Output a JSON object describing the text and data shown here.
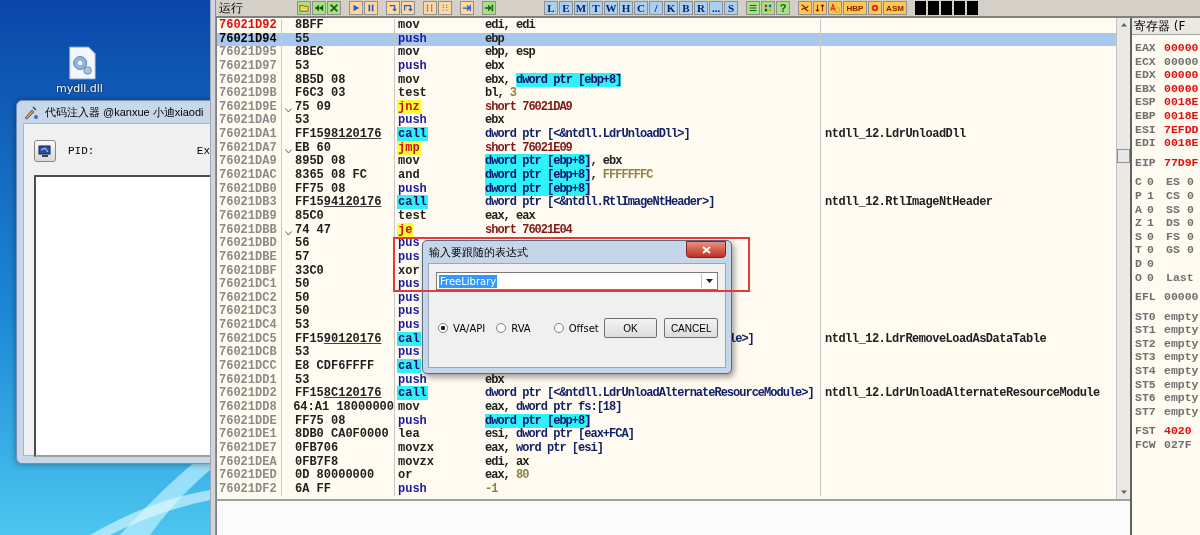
{
  "desktop": {
    "icon_label": "mydll.dll"
  },
  "injector": {
    "title": "代码注入器 @kanxue 小迪xiaodi",
    "pid_label": "PID:",
    "label_2": "Ex"
  },
  "toolbar": {
    "status": "运行",
    "letter_buttons": [
      "L",
      "E",
      "M",
      "T",
      "W",
      "H",
      "C",
      "/",
      "K",
      "B",
      "R",
      "...",
      "S"
    ],
    "help": "?",
    "text_icons": [
      "HBP",
      "ASM"
    ]
  },
  "rows": [
    {
      "address": "76021D92",
      "marked": true,
      "selected": false,
      "hex": "8BFF",
      "mnemonic": "mov",
      "kind": "plain",
      "operand": [
        {
          "kind": "plain",
          "text": "edi, edi"
        }
      ]
    },
    {
      "address": "76021D94",
      "marked": false,
      "selected": true,
      "hex": "55",
      "mnemonic": "push",
      "kind": "stack",
      "operand": [
        {
          "kind": "plain",
          "text": "ebp"
        }
      ]
    },
    {
      "address": "76021D95",
      "marked": false,
      "selected": false,
      "hex": "8BEC",
      "mnemonic": "mov",
      "kind": "plain",
      "operand": [
        {
          "kind": "plain",
          "text": "ebp, esp"
        }
      ]
    },
    {
      "address": "76021D97",
      "marked": false,
      "selected": false,
      "hex": "53",
      "mnemonic": "push",
      "kind": "stack",
      "operand": [
        {
          "kind": "plain",
          "text": "ebx"
        }
      ]
    },
    {
      "address": "76021D98",
      "marked": false,
      "selected": false,
      "hex": "8B5D 08",
      "mnemonic": "mov",
      "kind": "plain",
      "operand": [
        {
          "kind": "plain",
          "text": "ebx, "
        },
        {
          "kind": "mem",
          "text": "dword ptr [ebp+8]"
        }
      ]
    },
    {
      "address": "76021D9B",
      "marked": false,
      "selected": false,
      "hex": "F6C3 03",
      "mnemonic": "test",
      "kind": "plain",
      "operand": [
        {
          "kind": "plain",
          "text": "bl, "
        },
        {
          "kind": "const",
          "text": "3"
        }
      ]
    },
    {
      "address": "76021D9E",
      "marked": false,
      "selected": false,
      "hex": "75 09",
      "mnemonic": "jnz",
      "kind": "jump",
      "operand": [
        {
          "kind": "target",
          "text": "short 76021DA9"
        }
      ]
    },
    {
      "address": "76021DA0",
      "marked": false,
      "selected": false,
      "hex": "53",
      "mnemonic": "push",
      "kind": "stack",
      "operand": [
        {
          "kind": "plain",
          "text": "ebx"
        }
      ]
    },
    {
      "address": "76021DA1",
      "marked": false,
      "selected": false,
      "hex": "FF15",
      "fixup": "98120176",
      "mnemonic": "call",
      "kind": "call",
      "operand": [
        {
          "kind": "ref",
          "text": "dword ptr [<&ntdll.LdrUnloadDll>]"
        }
      ],
      "comment": "ntdll_12.LdrUnloadDll"
    },
    {
      "address": "76021DA7",
      "marked": false,
      "selected": false,
      "hex": "EB 60",
      "mnemonic": "jmp",
      "kind": "jump",
      "operand": [
        {
          "kind": "target",
          "text": "short 76021E09"
        }
      ]
    },
    {
      "address": "76021DA9",
      "marked": false,
      "selected": false,
      "hex": "895D 08",
      "mnemonic": "mov",
      "kind": "plain",
      "operand": [
        {
          "kind": "mem",
          "text": "dword ptr [ebp+8]"
        },
        {
          "kind": "plain",
          "text": ", ebx"
        }
      ]
    },
    {
      "address": "76021DAC",
      "marked": false,
      "selected": false,
      "hex": "8365 08 FC",
      "mnemonic": "and",
      "kind": "plain",
      "operand": [
        {
          "kind": "mem",
          "text": "dword ptr [ebp+8]"
        },
        {
          "kind": "plain",
          "text": ", "
        },
        {
          "kind": "const",
          "text": "FFFFFFFC"
        }
      ]
    },
    {
      "address": "76021DB0",
      "marked": false,
      "selected": false,
      "hex": "FF75 08",
      "mnemonic": "push",
      "kind": "stack",
      "operand": [
        {
          "kind": "mem",
          "text": "dword ptr [ebp+8]"
        }
      ]
    },
    {
      "address": "76021DB3",
      "marked": false,
      "selected": false,
      "hex": "FF15",
      "fixup": "94120176",
      "mnemonic": "call",
      "kind": "call",
      "operand": [
        {
          "kind": "ref",
          "text": "dword ptr [<&ntdll.RtlImageNtHeader>]"
        }
      ],
      "comment": "ntdll_12.RtlImageNtHeader"
    },
    {
      "address": "76021DB9",
      "marked": false,
      "selected": false,
      "hex": "85C0",
      "mnemonic": "test",
      "kind": "plain",
      "operand": [
        {
          "kind": "plain",
          "text": "eax, eax"
        }
      ]
    },
    {
      "address": "76021DBB",
      "marked": false,
      "selected": false,
      "hex": "74 47",
      "mnemonic": "je",
      "kind": "jump",
      "operand": [
        {
          "kind": "target",
          "text": "short 76021E04"
        }
      ]
    },
    {
      "address": "76021DBD",
      "marked": false,
      "selected": false,
      "hex": "56",
      "mnemonic": "pus",
      "kind": "stack",
      "operand": []
    },
    {
      "address": "76021DBE",
      "marked": false,
      "selected": false,
      "hex": "57",
      "mnemonic": "pus",
      "kind": "stack",
      "operand": []
    },
    {
      "address": "76021DBF",
      "marked": false,
      "selected": false,
      "hex": "33C0",
      "mnemonic": "xor",
      "kind": "plain",
      "operand": []
    },
    {
      "address": "76021DC1",
      "marked": false,
      "selected": false,
      "hex": "50",
      "mnemonic": "pus",
      "kind": "stack",
      "operand": []
    },
    {
      "address": "76021DC2",
      "marked": false,
      "selected": false,
      "hex": "50",
      "mnemonic": "pus",
      "kind": "stack",
      "operand": []
    },
    {
      "address": "76021DC3",
      "marked": false,
      "selected": false,
      "hex": "50",
      "mnemonic": "pus",
      "kind": "stack",
      "operand": []
    },
    {
      "address": "76021DC4",
      "marked": false,
      "selected": false,
      "hex": "53",
      "mnemonic": "pus",
      "kind": "stack",
      "operand": []
    },
    {
      "address": "76021DC5",
      "marked": false,
      "selected": false,
      "hex": "FF15",
      "fixup": "90120176",
      "mnemonic": "cal",
      "kind": "call",
      "operand": [],
      "operand_tail": "le>]",
      "comment": "ntdll_12.LdrRemoveLoadAsDataTable"
    },
    {
      "address": "76021DCB",
      "marked": false,
      "selected": false,
      "hex": "53",
      "mnemonic": "pus",
      "kind": "stack",
      "operand": []
    },
    {
      "address": "76021DCC",
      "marked": false,
      "selected": false,
      "hex": "E8 CDF6FFFF",
      "mnemonic": "cal",
      "kind": "call",
      "operand": []
    },
    {
      "address": "76021DD1",
      "marked": false,
      "selected": false,
      "hex": "53",
      "mnemonic": "push",
      "kind": "stack",
      "operand": [
        {
          "kind": "plain",
          "text": "ebx"
        }
      ]
    },
    {
      "address": "76021DD2",
      "marked": false,
      "selected": false,
      "hex": "FF15",
      "fixup": "8C120176",
      "mnemonic": "call",
      "kind": "call",
      "operand": [
        {
          "kind": "ref",
          "text": "dword ptr [<&ntdll.LdrUnloadAlternateResourceModule>]"
        }
      ],
      "comment": "ntdll_12.LdrUnloadAlternateResourceModule"
    },
    {
      "address": "76021DD8",
      "marked": false,
      "selected": false,
      "hex": "64:A1 18000000",
      "mnemonic": "mov",
      "kind": "plain",
      "operand": [
        {
          "kind": "plain",
          "text": "eax, "
        },
        {
          "kind": "ref",
          "text": "dword ptr fs:[18]"
        }
      ]
    },
    {
      "address": "76021DDE",
      "marked": false,
      "selected": false,
      "hex": "FF75 08",
      "mnemonic": "push",
      "kind": "stack",
      "operand": [
        {
          "kind": "mem",
          "text": "dword ptr [ebp+8]"
        }
      ]
    },
    {
      "address": "76021DE1",
      "marked": false,
      "selected": false,
      "hex": "8DB0 CA0F0000",
      "mnemonic": "lea",
      "kind": "plain",
      "operand": [
        {
          "kind": "plain",
          "text": "esi, "
        },
        {
          "kind": "ref",
          "text": "dword ptr [eax+FCA]"
        }
      ]
    },
    {
      "address": "76021DE7",
      "marked": false,
      "selected": false,
      "hex": "0FB706",
      "mnemonic": "movzx",
      "kind": "plain",
      "operand": [
        {
          "kind": "plain",
          "text": "eax, "
        },
        {
          "kind": "ref",
          "text": "word ptr [esi]"
        }
      ]
    },
    {
      "address": "76021DEA",
      "marked": false,
      "selected": false,
      "hex": "0FB7F8",
      "mnemonic": "movzx",
      "kind": "plain",
      "operand": [
        {
          "kind": "plain",
          "text": "edi, ax"
        }
      ]
    },
    {
      "address": "76021DED",
      "marked": false,
      "selected": false,
      "hex": "0D 80000000",
      "mnemonic": "or",
      "kind": "plain",
      "operand": [
        {
          "kind": "plain",
          "text": "eax, "
        },
        {
          "kind": "const",
          "text": "80"
        }
      ]
    },
    {
      "address": "76021DF2",
      "marked": false,
      "selected": false,
      "hex": "6A FF",
      "mnemonic": "push",
      "kind": "stack",
      "operand": [
        {
          "kind": "const",
          "text": "-1"
        }
      ]
    }
  ],
  "registers": {
    "title": "寄存器 (F",
    "general": [
      {
        "name": "EAX",
        "value": "00000",
        "changed": true
      },
      {
        "name": "ECX",
        "value": "00000",
        "changed": false
      },
      {
        "name": "EDX",
        "value": "00000",
        "changed": true
      },
      {
        "name": "EBX",
        "value": "00000",
        "changed": true
      },
      {
        "name": "ESP",
        "value": "0018E",
        "changed": true
      },
      {
        "name": "EBP",
        "value": "0018E",
        "changed": true
      },
      {
        "name": "ESI",
        "value": "7EFDD",
        "changed": true
      },
      {
        "name": "EDI",
        "value": "0018E",
        "changed": true
      }
    ],
    "eip": {
      "name": "EIP",
      "value": "77D9F",
      "changed": true
    },
    "flags": [
      {
        "flag": "C",
        "value": "0",
        "segment": "ES",
        "segment_value": "0"
      },
      {
        "flag": "P",
        "value": "1",
        "segment": "CS",
        "segment_value": "0"
      },
      {
        "flag": "A",
        "value": "0",
        "segment": "SS",
        "segment_value": "0"
      },
      {
        "flag": "Z",
        "value": "1",
        "segment": "DS",
        "segment_value": "0"
      },
      {
        "flag": "S",
        "value": "0",
        "segment": "FS",
        "segment_value": "0"
      },
      {
        "flag": "T",
        "value": "0",
        "segment": "GS",
        "segment_value": "0"
      },
      {
        "flag": "D",
        "value": "0"
      },
      {
        "flag": "O",
        "value": "0",
        "segment": "Last"
      }
    ],
    "efl": {
      "name": "EFL",
      "value": "00000",
      "changed": false
    },
    "fpu": [
      {
        "name": "ST0",
        "value": "empty"
      },
      {
        "name": "ST1",
        "value": "empty"
      },
      {
        "name": "ST2",
        "value": "empty"
      },
      {
        "name": "ST3",
        "value": "empty"
      },
      {
        "name": "ST4",
        "value": "empty"
      },
      {
        "name": "ST5",
        "value": "empty"
      },
      {
        "name": "ST6",
        "value": "empty"
      },
      {
        "name": "ST7",
        "value": "empty"
      }
    ],
    "status": [
      {
        "name": "FST",
        "value": "4020",
        "changed": true
      },
      {
        "name": "FCW",
        "value": "027F",
        "changed": false
      }
    ]
  },
  "dialog": {
    "title": "输入要跟随的表达式",
    "expression": "FreeLibrary",
    "text_selected": true,
    "options": [
      {
        "label": "VA/API",
        "selected": true
      },
      {
        "label": "RVA",
        "selected": false
      },
      {
        "label": "Offset",
        "selected": false
      }
    ],
    "buttons": [
      "OK",
      "CANCEL"
    ]
  }
}
